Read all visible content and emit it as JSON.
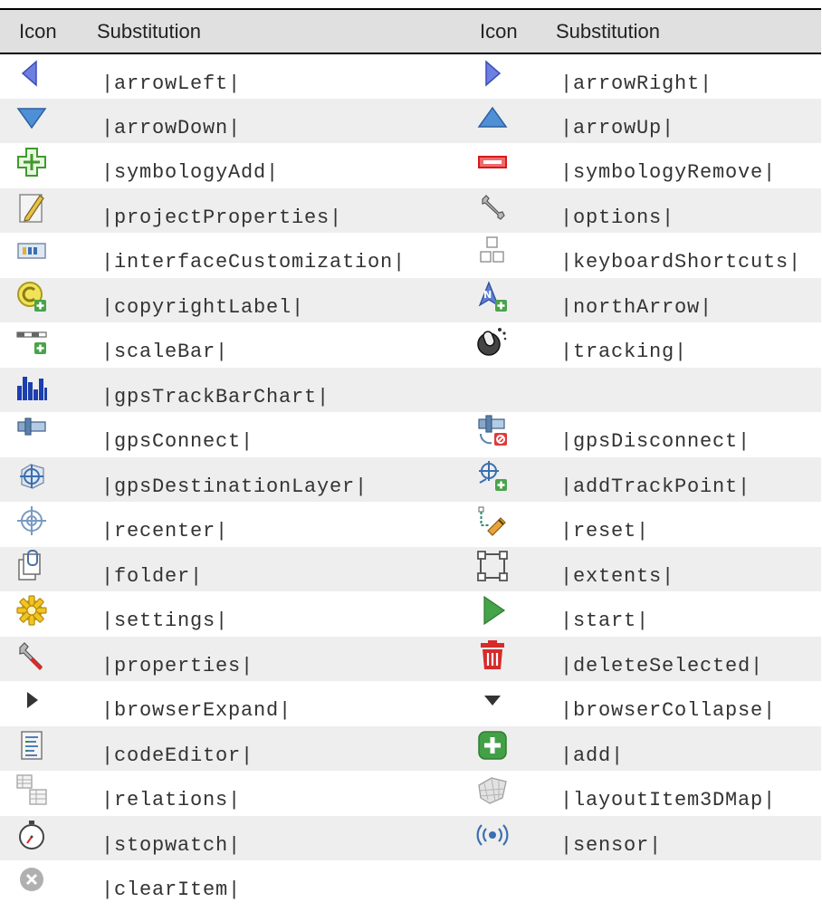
{
  "headers": [
    "Icon",
    "Substitution",
    "Icon",
    "Substitution"
  ],
  "rows": [
    [
      {
        "icon": "arrow-left-icon",
        "sub": "|arrowLeft|"
      },
      {
        "icon": "arrow-right-icon",
        "sub": "|arrowRight|"
      }
    ],
    [
      {
        "icon": "arrow-down-icon",
        "sub": "|arrowDown|"
      },
      {
        "icon": "arrow-up-icon",
        "sub": "|arrowUp|"
      }
    ],
    [
      {
        "icon": "symbology-add-icon",
        "sub": "|symbologyAdd|"
      },
      {
        "icon": "symbology-remove-icon",
        "sub": "|symbologyRemove|"
      }
    ],
    [
      {
        "icon": "project-properties-icon",
        "sub": "|projectProperties|"
      },
      {
        "icon": "options-icon",
        "sub": "|options|"
      }
    ],
    [
      {
        "icon": "interface-customization-icon",
        "sub": "|interfaceCustomization|"
      },
      {
        "icon": "keyboard-shortcuts-icon",
        "sub": "|keyboardShortcuts|"
      }
    ],
    [
      {
        "icon": "copyright-label-icon",
        "sub": "|copyrightLabel|"
      },
      {
        "icon": "north-arrow-icon",
        "sub": "|northArrow|"
      }
    ],
    [
      {
        "icon": "scale-bar-icon",
        "sub": "|scaleBar|"
      },
      {
        "icon": "tracking-icon",
        "sub": "|tracking|"
      }
    ],
    [
      {
        "icon": "gps-track-bar-chart-icon",
        "sub": "|gpsTrackBarChart|"
      },
      null
    ],
    [
      {
        "icon": "gps-connect-icon",
        "sub": "|gpsConnect|"
      },
      {
        "icon": "gps-disconnect-icon",
        "sub": "|gpsDisconnect|"
      }
    ],
    [
      {
        "icon": "gps-destination-layer-icon",
        "sub": "|gpsDestinationLayer|"
      },
      {
        "icon": "add-track-point-icon",
        "sub": "|addTrackPoint|"
      }
    ],
    [
      {
        "icon": "recenter-icon",
        "sub": "|recenter|"
      },
      {
        "icon": "reset-icon",
        "sub": "|reset|"
      }
    ],
    [
      {
        "icon": "folder-icon",
        "sub": "|folder|"
      },
      {
        "icon": "extents-icon",
        "sub": "|extents|"
      }
    ],
    [
      {
        "icon": "settings-icon",
        "sub": "|settings|"
      },
      {
        "icon": "start-icon",
        "sub": "|start|"
      }
    ],
    [
      {
        "icon": "properties-icon",
        "sub": "|properties|"
      },
      {
        "icon": "delete-selected-icon",
        "sub": "|deleteSelected|"
      }
    ],
    [
      {
        "icon": "browser-expand-icon",
        "sub": "|browserExpand|"
      },
      {
        "icon": "browser-collapse-icon",
        "sub": "|browserCollapse|"
      }
    ],
    [
      {
        "icon": "code-editor-icon",
        "sub": "|codeEditor|"
      },
      {
        "icon": "add-icon",
        "sub": "|add|"
      }
    ],
    [
      {
        "icon": "relations-icon",
        "sub": "|relations|"
      },
      {
        "icon": "layout-item-3d-map-icon",
        "sub": "|layoutItem3DMap|"
      }
    ],
    [
      {
        "icon": "stopwatch-icon",
        "sub": "|stopwatch|"
      },
      {
        "icon": "sensor-icon",
        "sub": "|sensor|"
      }
    ],
    [
      {
        "icon": "clear-item-icon",
        "sub": "|clearItem|"
      },
      null
    ]
  ]
}
